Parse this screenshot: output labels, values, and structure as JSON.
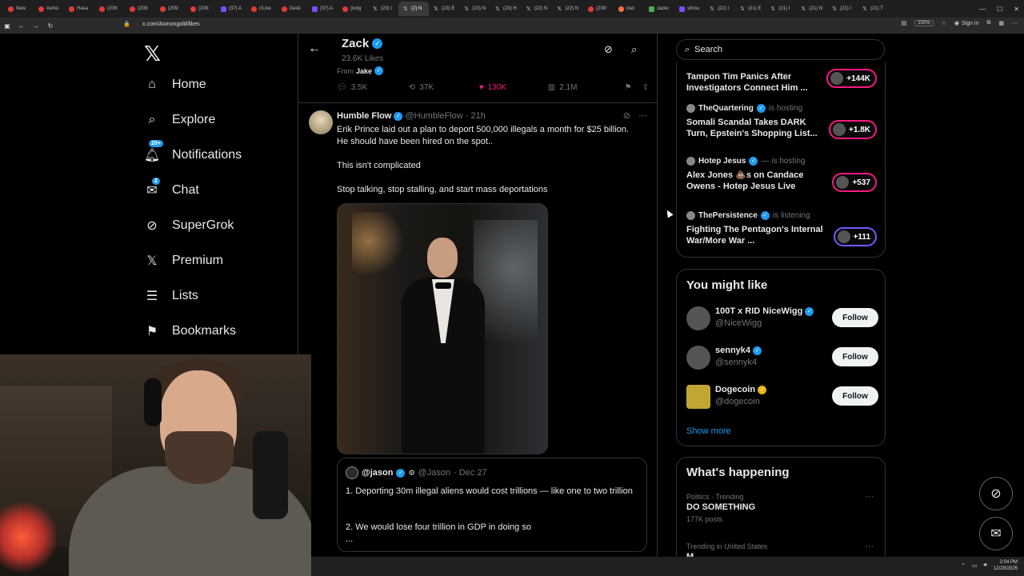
{
  "browser": {
    "tabs": [
      {
        "label": "New",
        "icon": "new-tab-icon"
      },
      {
        "label": "Asmo",
        "icon": "asmon-icon"
      },
      {
        "label": "Hasa",
        "icon": "youtube-icon"
      },
      {
        "label": "(209:",
        "icon": "youtube-icon"
      },
      {
        "label": "(209:",
        "icon": "youtube-icon"
      },
      {
        "label": "(209:",
        "icon": "youtube-icon"
      },
      {
        "label": "(209:",
        "icon": "youtube-icon"
      },
      {
        "label": "(37) A",
        "icon": "twitch-icon"
      },
      {
        "label": "r/Live",
        "icon": "reddit-icon"
      },
      {
        "label": "Desti",
        "icon": "youtube-icon"
      },
      {
        "label": "(37) A",
        "icon": "twitch-icon"
      },
      {
        "label": "(long",
        "icon": "youtube-icon"
      },
      {
        "label": "(23) I",
        "icon": "x-icon"
      },
      {
        "label": "(2) N",
        "icon": "x-icon",
        "active": true
      },
      {
        "label": "(23) E",
        "icon": "x-icon"
      },
      {
        "label": "(23) N",
        "icon": "x-icon"
      },
      {
        "label": "(23) H",
        "icon": "x-icon"
      },
      {
        "label": "(22) N",
        "icon": "x-icon"
      },
      {
        "label": "(22) N",
        "icon": "x-icon"
      },
      {
        "label": "(209:",
        "icon": "youtube-icon"
      },
      {
        "label": "iran",
        "icon": "google-icon"
      },
      {
        "label": "zackc",
        "icon": "zack-icon"
      },
      {
        "label": "shrou",
        "icon": "twitch-icon"
      },
      {
        "label": "(22) I",
        "icon": "x-icon"
      },
      {
        "label": "(21) E",
        "icon": "x-icon"
      },
      {
        "label": "(21) I",
        "icon": "x-icon"
      },
      {
        "label": "(21) N",
        "icon": "x-icon"
      },
      {
        "label": "(21) I",
        "icon": "x-icon"
      },
      {
        "label": "(21) T",
        "icon": "x-icon"
      }
    ],
    "url": "x.com/Asmongold/likes",
    "zoom": "150%",
    "signin": "Sign in"
  },
  "nav": {
    "items": [
      {
        "label": "Home",
        "icon": "home-icon"
      },
      {
        "label": "Explore",
        "icon": "search-icon"
      },
      {
        "label": "Notifications",
        "icon": "bell-icon",
        "badge": "20+"
      },
      {
        "label": "Chat",
        "icon": "mail-icon",
        "badge": "2"
      },
      {
        "label": "SuperGrok",
        "icon": "grok-icon"
      },
      {
        "label": "Premium",
        "icon": "x-logo-icon"
      },
      {
        "label": "Lists",
        "icon": "list-icon"
      },
      {
        "label": "Bookmarks",
        "icon": "bookmark-icon"
      }
    ]
  },
  "header": {
    "name": "Zack",
    "likes": "23.6K Likes"
  },
  "prev_tweet": {
    "from_label": "From",
    "from_name": "Jake",
    "replies": "3.5K",
    "reposts": "37K",
    "likes": "130K",
    "views": "2.1M"
  },
  "tweet": {
    "author": "Humble Flow",
    "handle": "@HumbleFlow",
    "time": "· 21h",
    "text1": "Erik Prince laid out a plan to deport 500,000 illegals a month for $25 billion. He should have been hired on the spot..",
    "text2": "This isn't complicated",
    "text3": "Stop talking, stop stalling, and start mass deportations"
  },
  "quote": {
    "author": "@jason",
    "handle": "@Jason",
    "time": "· Dec 27",
    "text1": "1. Deporting 30m illegal aliens would cost trillions — like one to two trillion",
    "text2": "2. We would lose four trillion in GDP in doing so",
    "ellipsis": "..."
  },
  "sidebar": {
    "search_placeholder": "Search",
    "spaces": [
      {
        "host": "",
        "status": "",
        "title": "Tampon Tim Panics After Investigators Connect Him ...",
        "count": "+144K",
        "pill": "pink"
      },
      {
        "host": "TheQuartering",
        "status": "is hosting",
        "title": "Somali Scandal Takes DARK Turn, Epstein's Shopping List...",
        "count": "+1.8K",
        "pill": "pink"
      },
      {
        "host": "Hotep Jesus",
        "status": "— is hosting",
        "title": "Alex Jones 💩s on Candace Owens - Hotep Jesus Live",
        "count": "+537",
        "pill": "pink"
      },
      {
        "host": "ThePersistence",
        "status": "is listening",
        "title": "Fighting The Pentagon's Internal War/More War ...",
        "count": "+111",
        "pill": "purple"
      }
    ],
    "you_might_like": {
      "title": "You might like",
      "accounts": [
        {
          "name": "100T x RID NiceWigg",
          "handle": "@NiceWigg",
          "badge": "blue",
          "button": "Follow"
        },
        {
          "name": "sennyk4",
          "handle": "@sennyk4",
          "badge": "blue",
          "button": "Follow"
        },
        {
          "name": "Dogecoin",
          "handle": "@dogecoin",
          "badge": "gold",
          "button": "Follow"
        }
      ],
      "show_more": "Show more"
    },
    "whats_happening": {
      "title": "What's happening",
      "trends": [
        {
          "meta": "Politics · Trending",
          "topic": "DO SOMETHING",
          "count": "177K posts"
        },
        {
          "meta": "Trending in United States",
          "topic": "M...",
          "count": ""
        }
      ]
    }
  },
  "taskbar": {
    "time": "2:04 PM",
    "date": "12/29/2025"
  },
  "colors": {
    "accent": "#1d9bf0",
    "like": "#f91880",
    "space_pink": "#f91880",
    "space_purple": "#7856ff",
    "gold_badge": "#e2b719"
  }
}
